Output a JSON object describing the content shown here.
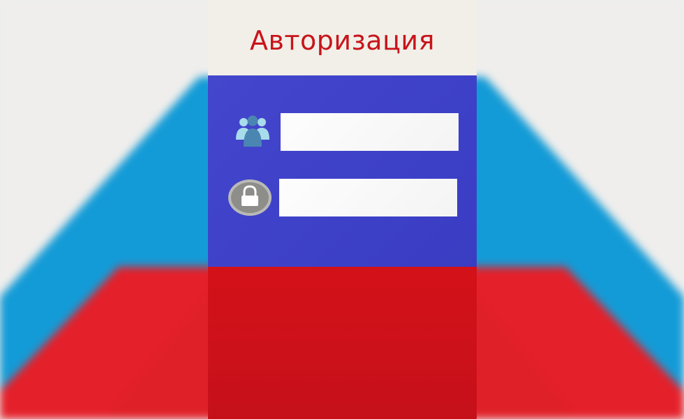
{
  "app": {
    "title": "Авторизация"
  },
  "form": {
    "username": {
      "value": "",
      "icon": "users-icon"
    },
    "password": {
      "value": "",
      "icon": "lock-icon"
    }
  },
  "colors": {
    "header_bg": "#f1efe8",
    "title": "#c8141a",
    "blue": "#3f43c8",
    "red": "#cf1119",
    "bg_blue": "#1a9ad6",
    "bg_red": "#e02028"
  }
}
